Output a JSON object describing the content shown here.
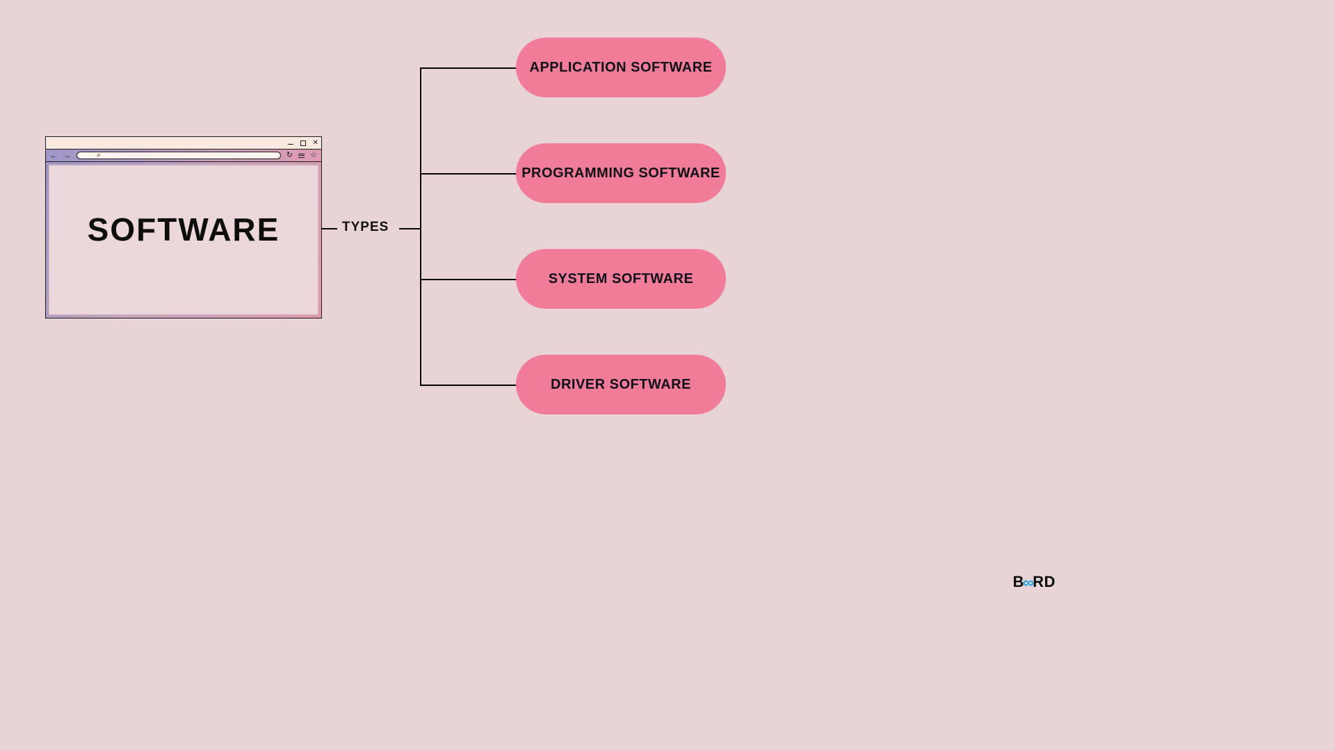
{
  "main": {
    "title": "SOFTWARE",
    "connector_label": "TYPES"
  },
  "types": [
    "APPLICATION SOFTWARE",
    "PROGRAMMING SOFTWARE",
    "SYSTEM SOFTWARE",
    "DRIVER SOFTWARE"
  ],
  "browser_icons": {
    "back": "←",
    "forward": "→",
    "search": "⌕",
    "reload": "↻",
    "star": "☆"
  },
  "logo": {
    "prefix": "B",
    "infinity": "∞",
    "suffix": "RD"
  }
}
